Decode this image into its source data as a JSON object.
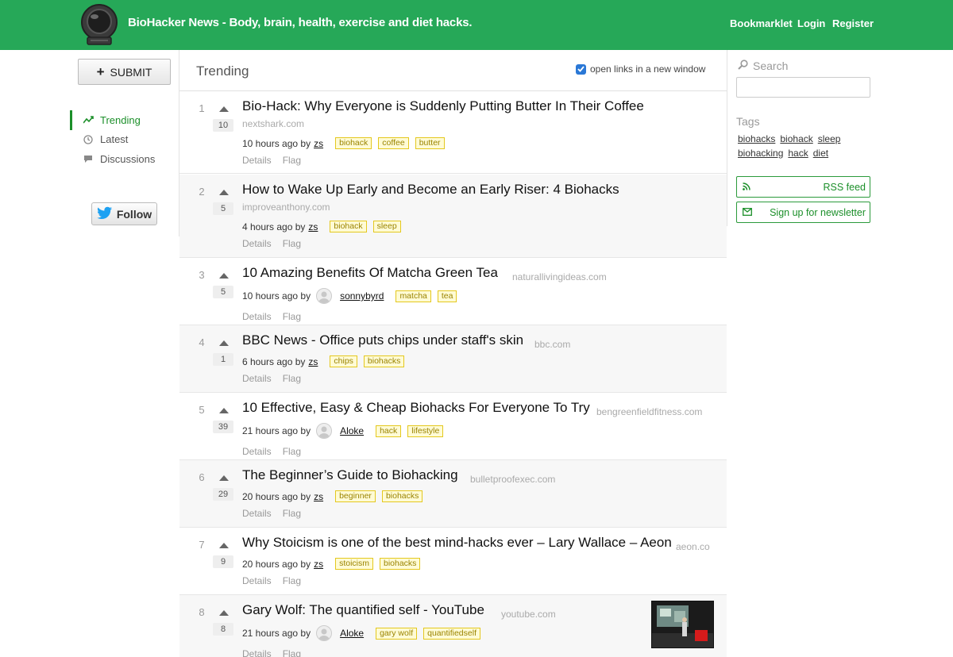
{
  "header": {
    "site_title": "BioHacker News - Body, brain, health, exercise and diet hacks.",
    "links": [
      "Bookmarklet",
      "Login",
      "Register"
    ],
    "brand_color": "#26a858"
  },
  "sidebar": {
    "submit_label": "SUBMIT",
    "nav": [
      {
        "label": "Trending",
        "icon": "trending-icon",
        "active": true
      },
      {
        "label": "Latest",
        "icon": "clock-icon",
        "active": false
      },
      {
        "label": "Discussions",
        "icon": "comment-icon",
        "active": false
      }
    ],
    "follow_label": "Follow"
  },
  "main": {
    "title": "Trending",
    "new_window_label": "open links in a new window",
    "new_window_checked": true,
    "actions": [
      "Details",
      "Flag"
    ],
    "stories": [
      {
        "rank": "1",
        "score": "10",
        "title": "Bio-Hack: Why Everyone is Suddenly Putting Butter In Their Coffee",
        "domain": "nextshark.com",
        "time": "10 hours ago by",
        "user": "zs",
        "tags": [
          "biohack",
          "coffee",
          "butter"
        ]
      },
      {
        "rank": "2",
        "score": "5",
        "title": "How to Wake Up Early and Become an Early Riser: 4 Biohacks",
        "domain": "improveanthony.com",
        "time": "4 hours ago by",
        "user": "zs",
        "tags": [
          "biohack",
          "sleep"
        ]
      },
      {
        "rank": "3",
        "score": "5",
        "title": "10 Amazing Benefits Of Matcha Green Tea",
        "domain": "naturallivingideas.com",
        "time": "10 hours ago by",
        "user": "sonnybyrd",
        "tags": [
          "matcha",
          "tea"
        ]
      },
      {
        "rank": "4",
        "score": "1",
        "title": "BBC News - Office puts chips under staff's skin",
        "domain": "bbc.com",
        "time": "6 hours ago by",
        "user": "zs",
        "tags": [
          "chips",
          "biohacks"
        ]
      },
      {
        "rank": "5",
        "score": "39",
        "title": "10 Effective, Easy & Cheap Biohacks For Everyone To Try",
        "domain": "bengreenfieldfitness.com",
        "time": "21 hours ago by",
        "user": "Aloke",
        "tags": [
          "hack",
          "lifestyle"
        ]
      },
      {
        "rank": "6",
        "score": "29",
        "title": "The Beginner’s Guide to Biohacking",
        "domain": "bulletproofexec.com",
        "time": "20 hours ago by",
        "user": "zs",
        "tags": [
          "beginner",
          "biohacks"
        ]
      },
      {
        "rank": "7",
        "score": "9",
        "title": "Why Stoicism is one of the best mind-hacks ever – Lary Wallace – Aeon",
        "domain": "aeon.co",
        "time": "20 hours ago by",
        "user": "zs",
        "tags": [
          "stoicism",
          "biohacks"
        ]
      },
      {
        "rank": "8",
        "score": "8",
        "title": "Gary Wolf: The quantified self - YouTube",
        "domain": "youtube.com",
        "time": "21 hours ago by",
        "user": "Aloke",
        "tags": [
          "gary wolf",
          "quantifiedself"
        ]
      }
    ]
  },
  "right": {
    "search_label": "Search",
    "search_value": "",
    "tags_label": "Tags",
    "tag_cloud": [
      "biohacks",
      "biohack",
      "sleep",
      "biohacking",
      "hack",
      "diet"
    ],
    "rss_label": "RSS feed",
    "newsletter_label": "Sign up for newsletter"
  }
}
